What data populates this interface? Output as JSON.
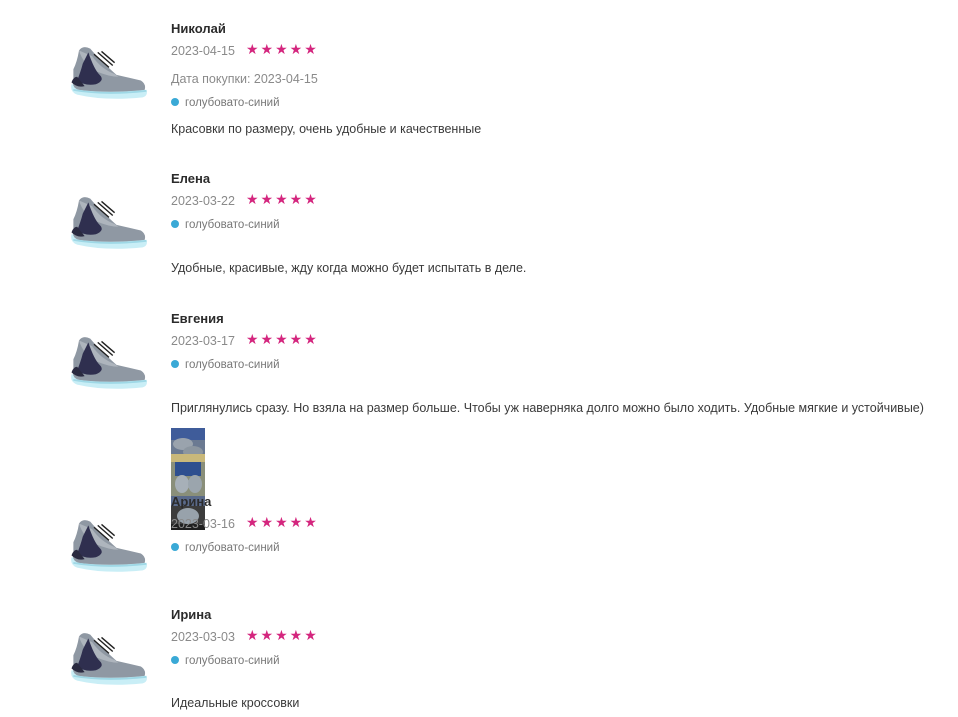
{
  "colors": {
    "star": "#d4267e",
    "color_dot": "#3aa9d6",
    "muted": "#8a8a8a"
  },
  "reviews": [
    {
      "name": "Николай",
      "date": "2023-04-15",
      "rating": 5,
      "purchase_label": "Дата покупки: 2023-04-15",
      "color": "голубовато-синий",
      "text": "Красовки по размеру, очень удобные и качественные",
      "product_image": "sneaker-thumbnail",
      "photos": []
    },
    {
      "name": "Елена",
      "date": "2023-03-22",
      "rating": 5,
      "color": "голубовато-синий",
      "text": "Удобные, красивые, жду когда можно будет испытать в деле.",
      "product_image": "sneaker-thumbnail",
      "photos": []
    },
    {
      "name": "Евгения",
      "date": "2023-03-17",
      "rating": 5,
      "color": "голубовато-синий",
      "text": "Приглянулись сразу. Но взяла на размер больше. Чтобы уж наверняка долго можно было ходить. Удобные мягкие и устойчивые)",
      "product_image": "sneaker-thumbnail",
      "photos": [
        "customer-photo-1",
        "customer-photo-2",
        "customer-photo-3"
      ]
    },
    {
      "name": "Арина",
      "date": "2023-03-16",
      "rating": 5,
      "color": "голубовато-синий",
      "text": "",
      "product_image": "sneaker-thumbnail",
      "photos": []
    },
    {
      "name": "Ирина",
      "date": "2023-03-03",
      "rating": 5,
      "color": "голубовато-синий",
      "text": "Идеальные кроссовки",
      "product_image": "sneaker-thumbnail",
      "photos": []
    }
  ],
  "star_glyph": "★★★★★"
}
